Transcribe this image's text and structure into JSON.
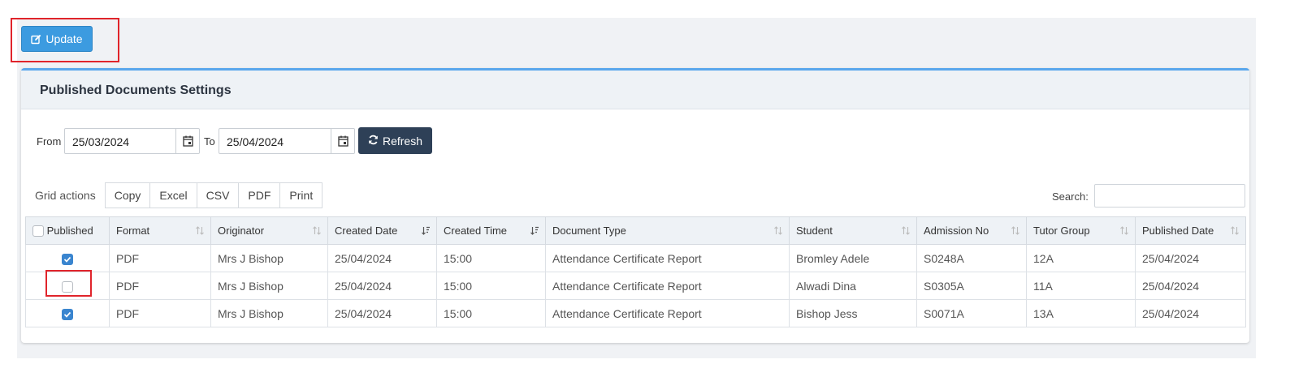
{
  "toolbar": {
    "update_label": "Update"
  },
  "card": {
    "title": "Published Documents Settings"
  },
  "filters": {
    "from_label": "From",
    "from_value": "25/03/2024",
    "to_label": "To",
    "to_value": "25/04/2024",
    "refresh_label": "Refresh"
  },
  "grid_actions": {
    "label": "Grid actions",
    "buttons": [
      "Copy",
      "Excel",
      "CSV",
      "PDF",
      "Print"
    ]
  },
  "search": {
    "label": "Search:",
    "value": ""
  },
  "table": {
    "columns": [
      "Published",
      "Format",
      "Originator",
      "Created Date",
      "Created Time",
      "Document Type",
      "Student",
      "Admission No",
      "Tutor Group",
      "Published Date"
    ],
    "rows": [
      {
        "published": true,
        "format": "PDF",
        "originator": "Mrs J Bishop",
        "created_date": "25/04/2024",
        "created_time": "15:00",
        "document_type": "Attendance Certificate Report",
        "student": "Bromley Adele",
        "admission_no": "S0248A",
        "tutor_group": "12A",
        "published_date": "25/04/2024"
      },
      {
        "published": false,
        "format": "PDF",
        "originator": "Mrs J Bishop",
        "created_date": "25/04/2024",
        "created_time": "15:00",
        "document_type": "Attendance Certificate Report",
        "student": "Alwadi Dina",
        "admission_no": "S0305A",
        "tutor_group": "11A",
        "published_date": "25/04/2024"
      },
      {
        "published": true,
        "format": "PDF",
        "originator": "Mrs J Bishop",
        "created_date": "25/04/2024",
        "created_time": "15:00",
        "document_type": "Attendance Certificate Report",
        "student": "Bishop Jess",
        "admission_no": "S0071A",
        "tutor_group": "13A",
        "published_date": "25/04/2024"
      }
    ]
  },
  "colors": {
    "update_button": "#3c9be0",
    "refresh_button": "#2e4057",
    "checkbox_checked": "#3a85cf",
    "highlight_box": "#e0242b",
    "card_accent": "#5aa7ec"
  }
}
